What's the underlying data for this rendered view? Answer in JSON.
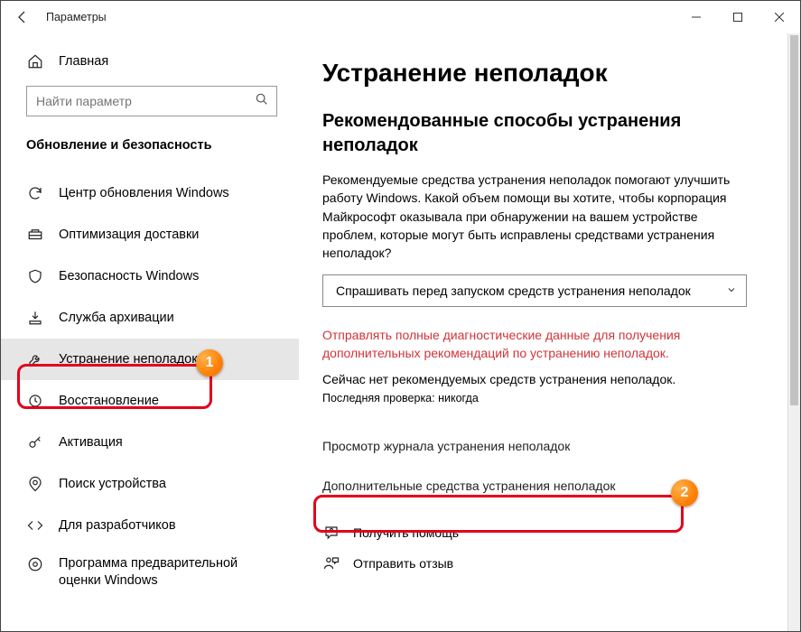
{
  "window": {
    "title": "Параметры"
  },
  "sidebar": {
    "home_label": "Главная",
    "search_placeholder": "Найти параметр",
    "section_heading": "Обновление и безопасность",
    "items": [
      {
        "id": "windows-update",
        "label": "Центр обновления Windows"
      },
      {
        "id": "delivery-opt",
        "label": "Оптимизация доставки"
      },
      {
        "id": "windows-security",
        "label": "Безопасность Windows"
      },
      {
        "id": "backup",
        "label": "Служба архивации"
      },
      {
        "id": "troubleshoot",
        "label": "Устранение неполадок"
      },
      {
        "id": "recovery",
        "label": "Восстановление"
      },
      {
        "id": "activation",
        "label": "Активация"
      },
      {
        "id": "find-device",
        "label": "Поиск устройства"
      },
      {
        "id": "for-developers",
        "label": "Для разработчиков"
      },
      {
        "id": "insider",
        "label": "Программа предварительной оценки Windows"
      }
    ]
  },
  "content": {
    "page_title": "Устранение неполадок",
    "subheading": "Рекомендованные способы устранения неполадок",
    "description": "Рекомендуемые средства устранения неполадок помогают улучшить работу Windows. Какой объем помощи вы хотите, чтобы корпорация Майкрософт оказывала при обнаружении на вашем устройстве проблем, которые могут быть исправлены средствами устранения неполадок?",
    "dropdown_value": "Спрашивать перед запуском средств устранения неполадок",
    "warning_text": "Отправлять полные диагностические данные для получения дополнительных рекомендаций по устранению неполадок.",
    "status_text": "Сейчас нет рекомендуемых средств устранения неполадок.",
    "last_check": "Последняя проверка: никогда",
    "history_link": "Просмотр журнала устранения неполадок",
    "additional_link": "Дополнительные средства устранения неполадок",
    "get_help": "Получить помощь",
    "feedback": "Отправить отзыв"
  },
  "callouts": {
    "badge1": "1",
    "badge2": "2"
  }
}
